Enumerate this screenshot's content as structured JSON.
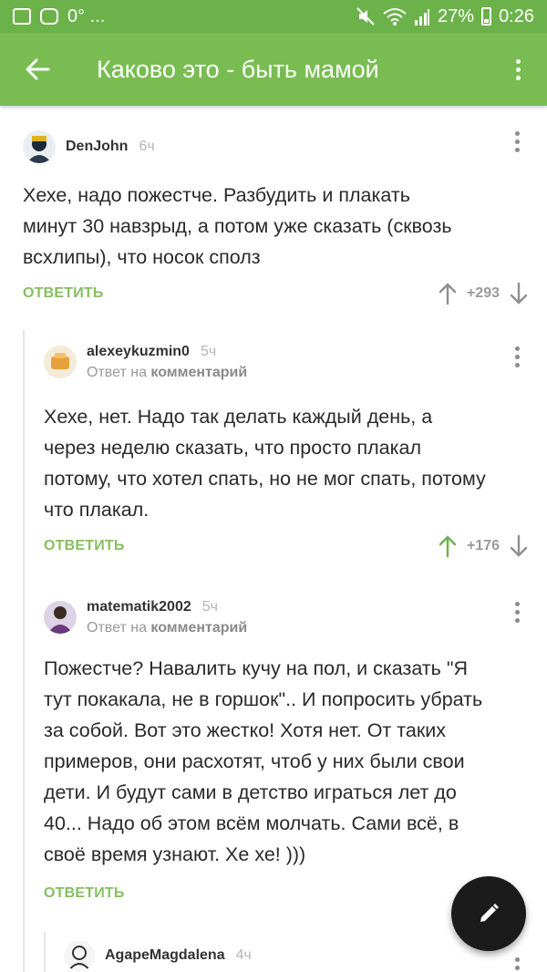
{
  "status_bar": {
    "temp": "0° ...",
    "battery": "27%",
    "time": "0:26"
  },
  "app_bar": {
    "title": "Каково это - быть мамой"
  },
  "comments": [
    {
      "username": "DenJohn",
      "time": "6ч",
      "reply_label": "",
      "reply_link": "",
      "text": "Хехе, надо пожестче. Разбудить и плакать\nминут 30 навзрыд, а потом уже сказать (сквозь\nвсхлипы), что носок сполз",
      "reply_button": "ОТВЕТИТЬ",
      "score": "+293",
      "upvoted": false
    },
    {
      "username": "alexeykuzmin0",
      "time": "5ч",
      "reply_label": "Ответ на",
      "reply_link": "комментарий",
      "text": "Хехе, нет. Надо так делать каждый день, а\nчерез неделю сказать, что просто плакал\nпотому, что хотел спать, но не мог спать, потому\nчто плакал.",
      "reply_button": "ОТВЕТИТЬ",
      "score": "+176",
      "upvoted": true
    },
    {
      "username": "matematik2002",
      "time": "5ч",
      "reply_label": "Ответ на",
      "reply_link": "комментарий",
      "text": "Пожестче? Навалить кучу на пол, и сказать \"Я\nтут покакала, не в горшок\".. И попросить убрать\nза собой. Вот это жестко! Хотя нет. От таких\nпримеров, они расхотят, чтоб у них были свои\nдети. И будут сами в детство играться лет до\n40... Надо об этом всём молчать. Сами всё, в\nсвоё время узнают. Хе хе! )))",
      "reply_button": "ОТВЕТИТЬ",
      "score": "",
      "upvoted": false
    },
    {
      "username": "AgapeMagdalena",
      "time": "4ч"
    }
  ],
  "colors": {
    "accent": "#79bd52",
    "status_bar": "#6cb24a",
    "upvote_active": "#6cb24a",
    "fab": "#1b1b1b"
  },
  "icons": [
    "image-icon",
    "instagram-icon",
    "mute-icon",
    "wifi-icon",
    "signal-icon",
    "battery-icon",
    "back-arrow-icon",
    "more-vert-icon",
    "upvote-icon",
    "downvote-icon",
    "pencil-icon"
  ]
}
